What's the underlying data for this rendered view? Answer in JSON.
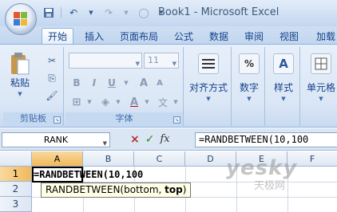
{
  "window": {
    "title": "Book1 - Microsoft Excel"
  },
  "quick_access": {
    "icons": [
      "save-icon",
      "undo-icon",
      "redo-icon",
      "customize-icon"
    ]
  },
  "ribbon_tabs": [
    {
      "label": "开始",
      "active": true
    },
    {
      "label": "插入"
    },
    {
      "label": "页面布局"
    },
    {
      "label": "公式"
    },
    {
      "label": "数据"
    },
    {
      "label": "审阅"
    },
    {
      "label": "视图"
    },
    {
      "label": "加载"
    }
  ],
  "groups": {
    "clipboard": {
      "label": "剪贴板",
      "paste_label": "粘贴"
    },
    "font": {
      "label": "字体",
      "font_name": "",
      "font_size": "11",
      "bold": "B",
      "italic": "I",
      "underline": "U",
      "grow": "A",
      "shrink": "A",
      "color_glyph": "A",
      "phonetic": "文"
    },
    "alignment": {
      "label": "对齐方式"
    },
    "number": {
      "label": "数字",
      "glyph": "%"
    },
    "styles": {
      "label": "样式"
    },
    "cells": {
      "label": "单元格"
    }
  },
  "formula_bar": {
    "name_box": "RANK",
    "cancel": "×",
    "enter": "✓",
    "fx": "fx",
    "content": "=RANDBETWEEN(10,100"
  },
  "sheet": {
    "columns": [
      "A",
      "B",
      "C",
      "D",
      "E",
      "F"
    ],
    "rows": [
      "1",
      "2",
      "3"
    ],
    "active_cell_text": "=RANDBETWEEN(10,100",
    "tooltip": {
      "fn": "RANDBETWEEN(bottom, ",
      "arg": "top",
      "close": ")"
    }
  },
  "watermark": {
    "main": "yesky",
    "sub": "天极网"
  },
  "colors": {
    "tab_text": "#15428b",
    "selected_header": "#f1b95a",
    "tooltip_bg": "#ffffe7"
  }
}
